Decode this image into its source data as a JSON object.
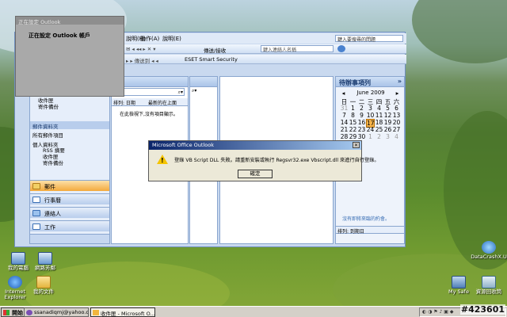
{
  "outlook": {
    "menubar": [
      "說明(H)",
      "動作(A)",
      "說明(E)"
    ],
    "search_placeholder": "鍵入要搜尋的問題",
    "toolbar1": {
      "send_receive": "傳送/接收",
      "search_placeholder": "鍵入連絡人名稱"
    },
    "toolbar2": {
      "eset_label": "ESET Smart Security"
    },
    "nav": {
      "folders": [
        "收件匣",
        "寄件備份"
      ],
      "section_header": "郵件資料夾",
      "all_items": "所有郵件項目",
      "personal_folders": "個人資料夾",
      "subfolders": [
        "RSS 摘要",
        "收件匣",
        "寄件備份"
      ],
      "big_buttons": [
        "郵件",
        "行事曆",
        "連絡人",
        "工作"
      ]
    },
    "mail_list": {
      "sort_label": "排列: 日期",
      "sort_order": "最新的在上面",
      "empty_message": "在此檢視下,沒有項目顯示。"
    },
    "todo": {
      "title": "待辦事項列",
      "month": "June 2009",
      "weekdays": [
        "日",
        "一",
        "二",
        "三",
        "四",
        "五",
        "六"
      ],
      "weeks": [
        [
          "31",
          "1",
          "2",
          "3",
          "4",
          "5",
          "6"
        ],
        [
          "7",
          "8",
          "9",
          "10",
          "11",
          "12",
          "13"
        ],
        [
          "14",
          "15",
          "16",
          "17",
          "18",
          "19",
          "20"
        ],
        [
          "21",
          "22",
          "23",
          "24",
          "25",
          "26",
          "27"
        ],
        [
          "28",
          "29",
          "30",
          "1",
          "2",
          "3",
          "4"
        ]
      ],
      "today": "17",
      "no_appointments": "沒有即將來臨的約會。",
      "sort_label": "排列: 到期日"
    }
  },
  "login_dialog": {
    "title": "正在設定 Outlook",
    "message": "正在設定 Outlook 帳戶"
  },
  "error_dialog": {
    "title": "Microsoft Office Outlook",
    "message": "登錄 VB Script DLL 失敗。請重新安裝或執行 Regsvr32.exe Vbscript.dll 來進行自行登錄。",
    "ok_label": "確定"
  },
  "desktop_icons": [
    "我的電腦",
    "網路芳鄰",
    "Internet Explorer",
    "我的文件",
    "DataCrashX.U",
    "My Safe",
    "資源回收筒"
  ],
  "taskbar": {
    "start_label": "開始",
    "buttons": [
      "ssanadiqmj@yahoo.c...",
      "收件匣 - Microsoft O..."
    ]
  },
  "watermark": "#423601",
  "colors": {
    "todo_today": "#f7b44a",
    "nav_selected": "#f7b44a",
    "dialog_title": "#0a246a"
  }
}
